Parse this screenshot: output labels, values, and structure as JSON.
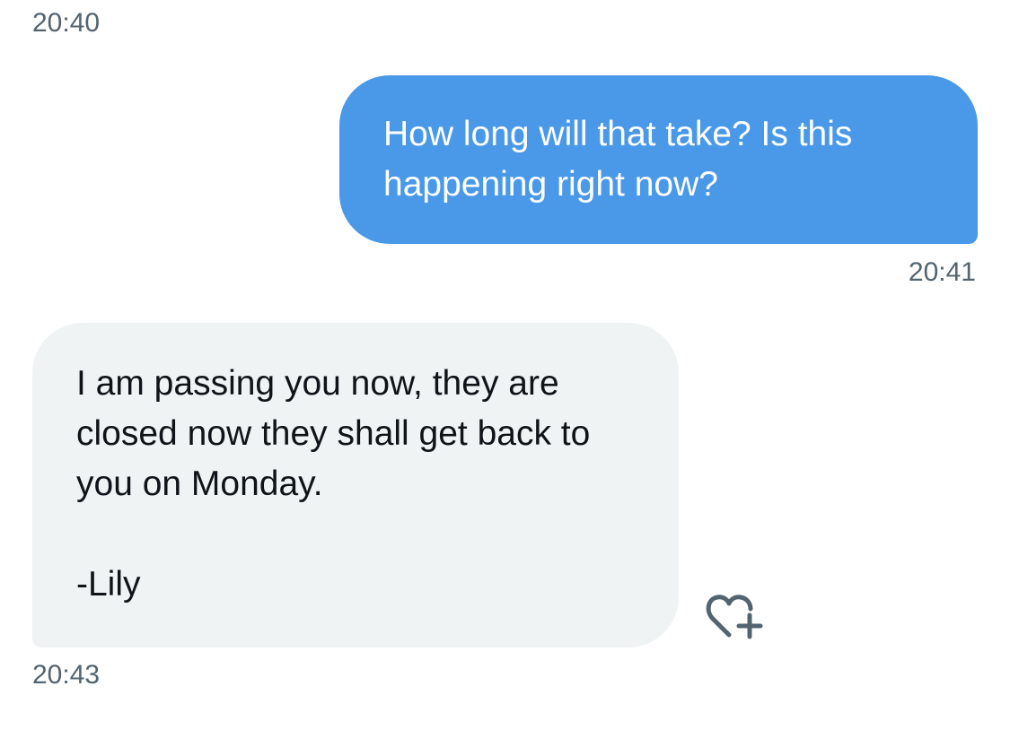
{
  "conversation": {
    "messages": [
      {
        "direction": "received",
        "timestamp": "20:40"
      },
      {
        "direction": "sent",
        "text": "How long will that take? Is this happening right now?",
        "timestamp": "20:41"
      },
      {
        "direction": "received",
        "text": "I am passing you now, they are closed now they shall get back to you on Monday.\n\n-Lily",
        "timestamp": "20:43"
      }
    ],
    "reaction_icon": "heart-plus-icon",
    "colors": {
      "sent_bubble": "#4a99e9",
      "received_bubble": "#eff3f4",
      "timestamp": "#536471",
      "icon": "#536471"
    }
  }
}
